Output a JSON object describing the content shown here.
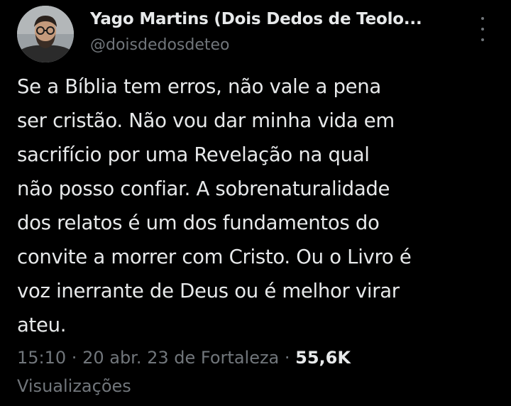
{
  "tweet": {
    "author": {
      "display_name": "Yago Martins (Dois Dedos de Teolo...",
      "handle": "@doisdedosdeteo",
      "avatar_icon": "profile-photo-avatar"
    },
    "more_icon": "more-vertical-icon",
    "text_lines": [
      "Se a Bíblia tem erros, não vale a pena",
      "ser cristão. Não vou dar minha vida em",
      "sacrifício por uma Revelação na qual",
      "não posso confiar. A sobrenaturalidade",
      "dos relatos é um dos fundamentos do",
      "convite a morrer com Cristo. Ou o Livro é",
      "voz inerrante de Deus ou é melhor virar",
      "ateu."
    ],
    "time": "15:10",
    "separator": " · ",
    "date": "20 abr. 23",
    "location": "de Fortaleza",
    "views_count": "55,6K",
    "views_label": "Visualizações"
  },
  "colors": {
    "background": "#000000",
    "primary_text": "#e7e9ea",
    "secondary_text": "#71767b"
  }
}
